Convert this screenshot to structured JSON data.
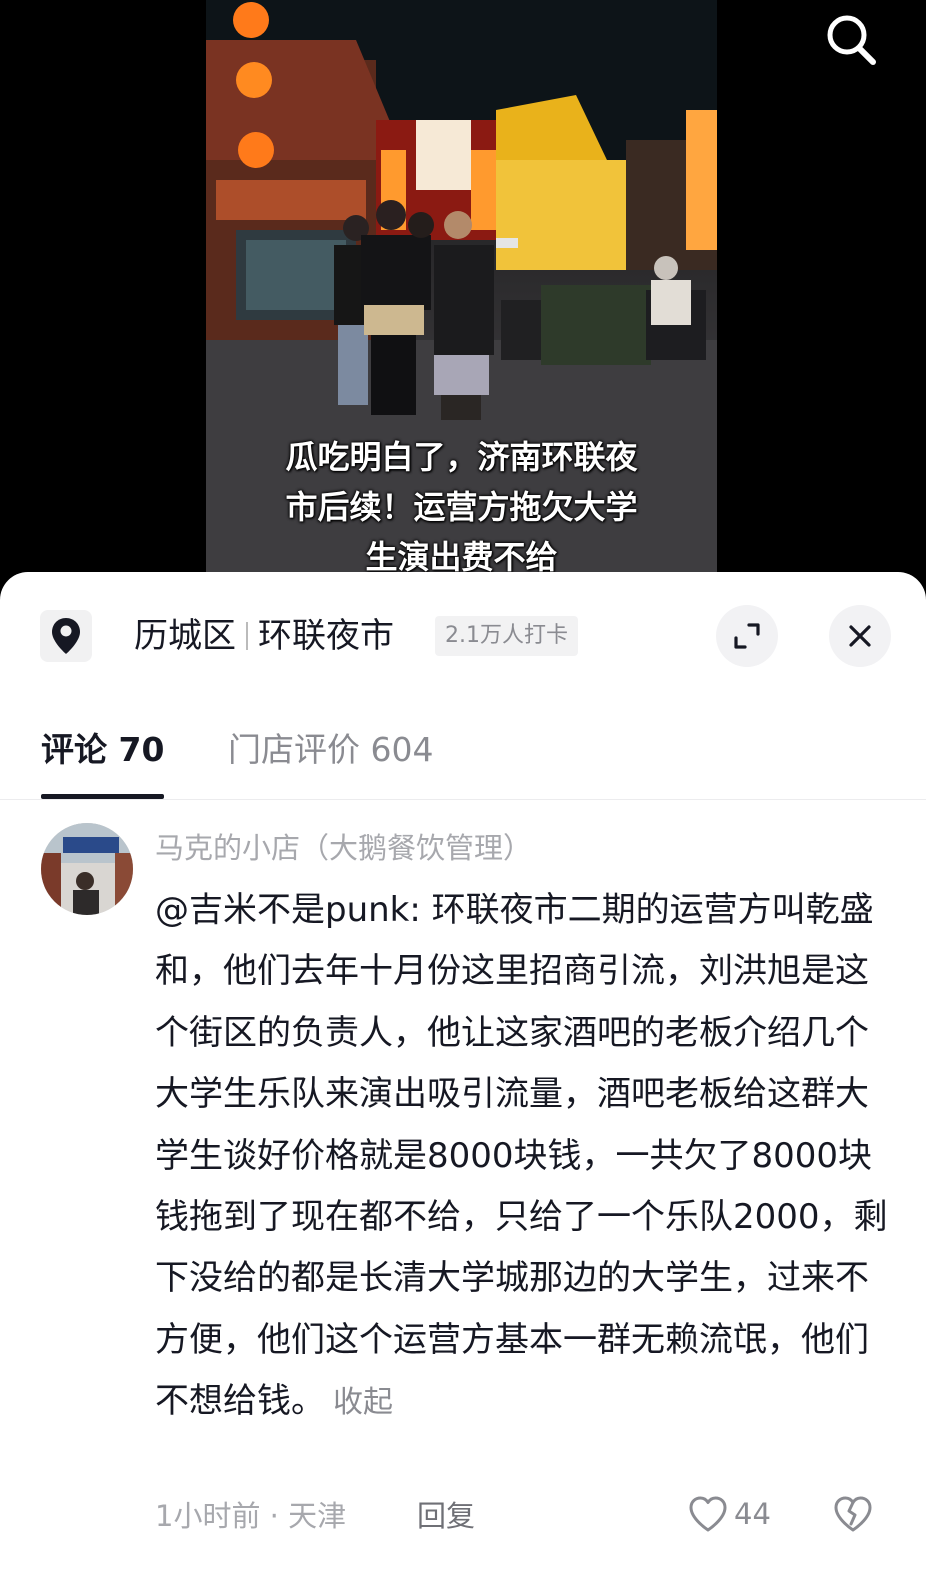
{
  "video": {
    "caption": "瓜吃明白了，济南环联夜\n市后续！运营方拖欠大学\n生演出费不给",
    "search_icon": "search-icon"
  },
  "location": {
    "district": "历城区",
    "place": "环联夜市",
    "checkins": "2.1万人打卡",
    "pin_icon": "location-pin-icon",
    "expand_icon": "expand-icon",
    "close_icon": "close-icon"
  },
  "tabs": [
    {
      "label": "评论 70",
      "active": true
    },
    {
      "label": "门店评价 604",
      "active": false
    }
  ],
  "comment": {
    "username": "马克的小店（大鹅餐饮管理）",
    "text": "@吉米不是punk: 环联夜市二期的运营方叫乾盛和，他们去年十月份这里招商引流，刘洪旭是这个街区的负责人，他让这家酒吧的老板介绍几个大学生乐队来演出吸引流量，酒吧老板给这群大学生谈好价格就是8000块钱，一共欠了8000块钱拖到了现在都不给，只给了一个乐队2000，剩下没给的都是长清大学城那边的大学生，过来不方便，他们这个运营方基本一群无赖流氓，他们不想给钱。",
    "collapse_label": "收起",
    "time_location": "1小时前 · 天津",
    "reply_label": "回复",
    "like_count": "44",
    "like_icon": "heart-icon",
    "dislike_icon": "broken-heart-icon"
  },
  "colors": {
    "text_primary": "#161823",
    "text_secondary": "#8a8b91",
    "sheet_bg": "#ffffff"
  }
}
